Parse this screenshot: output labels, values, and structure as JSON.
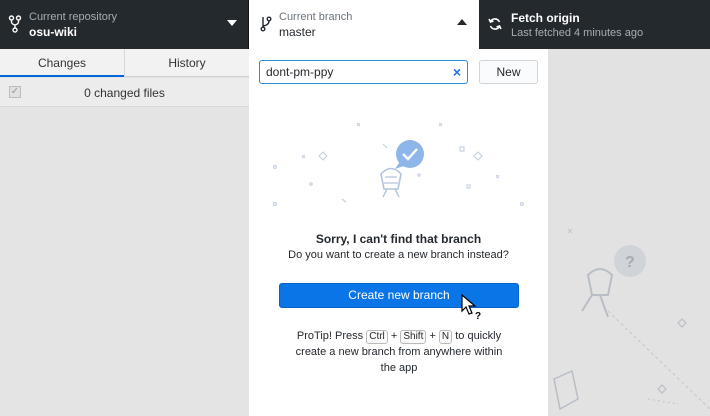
{
  "toolbar": {
    "repo": {
      "label": "Current repository",
      "value": "osu-wiki"
    },
    "branch": {
      "label": "Current branch",
      "value": "master"
    },
    "fetch": {
      "title": "Fetch origin",
      "subtitle": "Last fetched 4 minutes ago"
    }
  },
  "left": {
    "tabs": {
      "changes": "Changes",
      "history": "History"
    },
    "changed_files": "0 changed files"
  },
  "dropdown": {
    "filter_value": "dont-pm-ppy",
    "clear_label": "×",
    "new_label": "New",
    "no_match_title": "Sorry, I can't find that branch",
    "no_match_subtitle": "Do you want to create a new branch instead?",
    "create_label": "Create new branch",
    "protip": {
      "pre": "ProTip! Press",
      "k1": "Ctrl",
      "plus1": "+",
      "k2": "Shift",
      "plus2": "+",
      "k3": "N",
      "post": "to quickly create a new branch from anywhere within the app"
    }
  },
  "colors": {
    "toolbar_bg": "#24292e",
    "accent_blue": "#0a75e6",
    "input_focus": "#2f8bd6"
  }
}
